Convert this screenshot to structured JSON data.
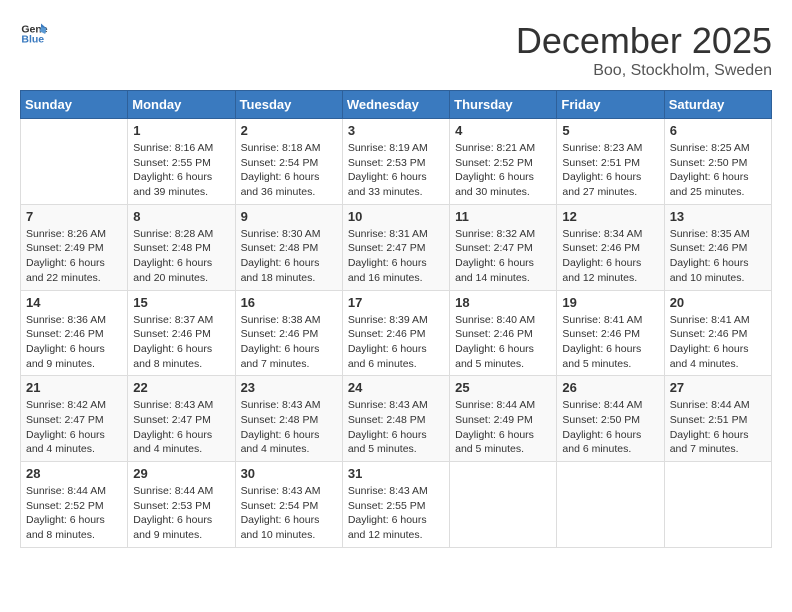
{
  "header": {
    "logo_general": "General",
    "logo_blue": "Blue",
    "month_title": "December 2025",
    "location": "Boo, Stockholm, Sweden"
  },
  "calendar": {
    "days_of_week": [
      "Sunday",
      "Monday",
      "Tuesday",
      "Wednesday",
      "Thursday",
      "Friday",
      "Saturday"
    ],
    "weeks": [
      [
        {
          "day": "",
          "info": ""
        },
        {
          "day": "1",
          "info": "Sunrise: 8:16 AM\nSunset: 2:55 PM\nDaylight: 6 hours\nand 39 minutes."
        },
        {
          "day": "2",
          "info": "Sunrise: 8:18 AM\nSunset: 2:54 PM\nDaylight: 6 hours\nand 36 minutes."
        },
        {
          "day": "3",
          "info": "Sunrise: 8:19 AM\nSunset: 2:53 PM\nDaylight: 6 hours\nand 33 minutes."
        },
        {
          "day": "4",
          "info": "Sunrise: 8:21 AM\nSunset: 2:52 PM\nDaylight: 6 hours\nand 30 minutes."
        },
        {
          "day": "5",
          "info": "Sunrise: 8:23 AM\nSunset: 2:51 PM\nDaylight: 6 hours\nand 27 minutes."
        },
        {
          "day": "6",
          "info": "Sunrise: 8:25 AM\nSunset: 2:50 PM\nDaylight: 6 hours\nand 25 minutes."
        }
      ],
      [
        {
          "day": "7",
          "info": "Sunrise: 8:26 AM\nSunset: 2:49 PM\nDaylight: 6 hours\nand 22 minutes."
        },
        {
          "day": "8",
          "info": "Sunrise: 8:28 AM\nSunset: 2:48 PM\nDaylight: 6 hours\nand 20 minutes."
        },
        {
          "day": "9",
          "info": "Sunrise: 8:30 AM\nSunset: 2:48 PM\nDaylight: 6 hours\nand 18 minutes."
        },
        {
          "day": "10",
          "info": "Sunrise: 8:31 AM\nSunset: 2:47 PM\nDaylight: 6 hours\nand 16 minutes."
        },
        {
          "day": "11",
          "info": "Sunrise: 8:32 AM\nSunset: 2:47 PM\nDaylight: 6 hours\nand 14 minutes."
        },
        {
          "day": "12",
          "info": "Sunrise: 8:34 AM\nSunset: 2:46 PM\nDaylight: 6 hours\nand 12 minutes."
        },
        {
          "day": "13",
          "info": "Sunrise: 8:35 AM\nSunset: 2:46 PM\nDaylight: 6 hours\nand 10 minutes."
        }
      ],
      [
        {
          "day": "14",
          "info": "Sunrise: 8:36 AM\nSunset: 2:46 PM\nDaylight: 6 hours\nand 9 minutes."
        },
        {
          "day": "15",
          "info": "Sunrise: 8:37 AM\nSunset: 2:46 PM\nDaylight: 6 hours\nand 8 minutes."
        },
        {
          "day": "16",
          "info": "Sunrise: 8:38 AM\nSunset: 2:46 PM\nDaylight: 6 hours\nand 7 minutes."
        },
        {
          "day": "17",
          "info": "Sunrise: 8:39 AM\nSunset: 2:46 PM\nDaylight: 6 hours\nand 6 minutes."
        },
        {
          "day": "18",
          "info": "Sunrise: 8:40 AM\nSunset: 2:46 PM\nDaylight: 6 hours\nand 5 minutes."
        },
        {
          "day": "19",
          "info": "Sunrise: 8:41 AM\nSunset: 2:46 PM\nDaylight: 6 hours\nand 5 minutes."
        },
        {
          "day": "20",
          "info": "Sunrise: 8:41 AM\nSunset: 2:46 PM\nDaylight: 6 hours\nand 4 minutes."
        }
      ],
      [
        {
          "day": "21",
          "info": "Sunrise: 8:42 AM\nSunset: 2:47 PM\nDaylight: 6 hours\nand 4 minutes."
        },
        {
          "day": "22",
          "info": "Sunrise: 8:43 AM\nSunset: 2:47 PM\nDaylight: 6 hours\nand 4 minutes."
        },
        {
          "day": "23",
          "info": "Sunrise: 8:43 AM\nSunset: 2:48 PM\nDaylight: 6 hours\nand 4 minutes."
        },
        {
          "day": "24",
          "info": "Sunrise: 8:43 AM\nSunset: 2:48 PM\nDaylight: 6 hours\nand 5 minutes."
        },
        {
          "day": "25",
          "info": "Sunrise: 8:44 AM\nSunset: 2:49 PM\nDaylight: 6 hours\nand 5 minutes."
        },
        {
          "day": "26",
          "info": "Sunrise: 8:44 AM\nSunset: 2:50 PM\nDaylight: 6 hours\nand 6 minutes."
        },
        {
          "day": "27",
          "info": "Sunrise: 8:44 AM\nSunset: 2:51 PM\nDaylight: 6 hours\nand 7 minutes."
        }
      ],
      [
        {
          "day": "28",
          "info": "Sunrise: 8:44 AM\nSunset: 2:52 PM\nDaylight: 6 hours\nand 8 minutes."
        },
        {
          "day": "29",
          "info": "Sunrise: 8:44 AM\nSunset: 2:53 PM\nDaylight: 6 hours\nand 9 minutes."
        },
        {
          "day": "30",
          "info": "Sunrise: 8:43 AM\nSunset: 2:54 PM\nDaylight: 6 hours\nand 10 minutes."
        },
        {
          "day": "31",
          "info": "Sunrise: 8:43 AM\nSunset: 2:55 PM\nDaylight: 6 hours\nand 12 minutes."
        },
        {
          "day": "",
          "info": ""
        },
        {
          "day": "",
          "info": ""
        },
        {
          "day": "",
          "info": ""
        }
      ]
    ]
  }
}
